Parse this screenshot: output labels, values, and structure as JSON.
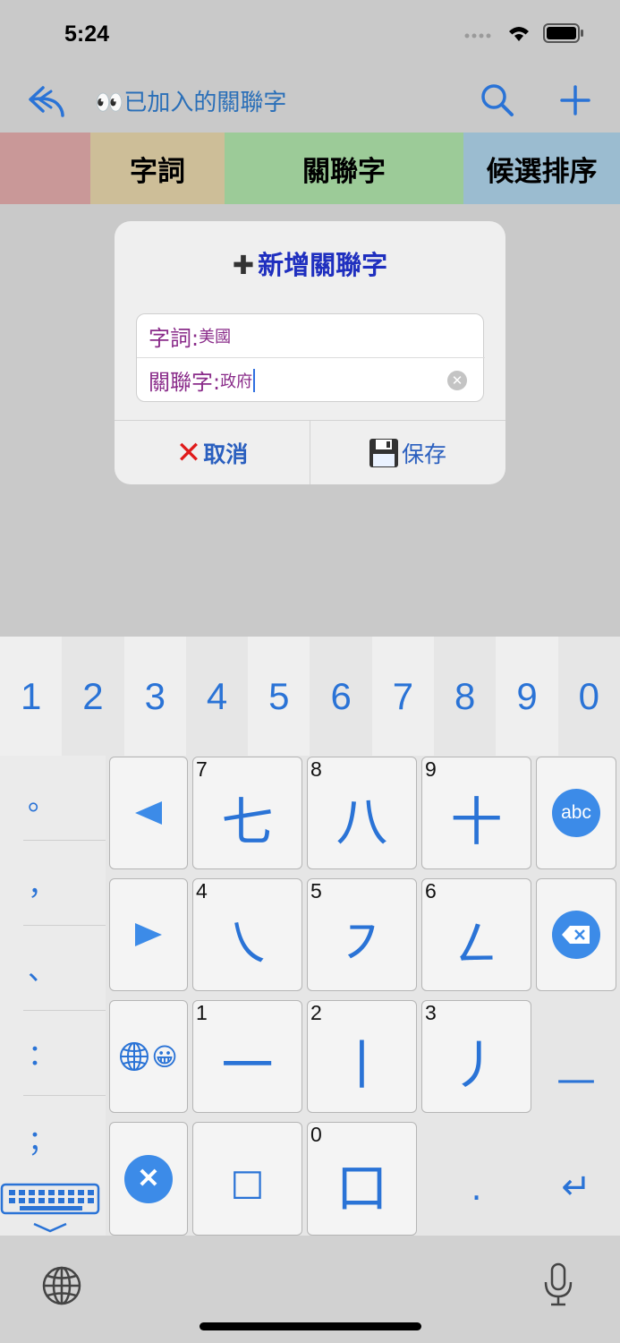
{
  "status": {
    "time": "5:24"
  },
  "nav": {
    "title": "👀已加入的關聯字"
  },
  "tabs": [
    "",
    "字詞",
    "關聯字",
    "候選排序"
  ],
  "dialog": {
    "title_icon": "✚",
    "title": "新增關聯字",
    "fields": [
      {
        "label": "字詞:",
        "value": "美國"
      },
      {
        "label": "關聯字:",
        "value": "政府"
      }
    ],
    "cancel_label": "取消",
    "cancel_icon": "✕",
    "save_label": "保存",
    "save_icon": "floppy-disk-icon"
  },
  "keyboard": {
    "numbers": [
      "1",
      "2",
      "3",
      "4",
      "5",
      "6",
      "7",
      "8",
      "9",
      "0"
    ],
    "punctuation": [
      "。",
      "，",
      "、",
      "：",
      "；"
    ],
    "stroke_keys": [
      {
        "digit": "7",
        "stroke": "七"
      },
      {
        "digit": "8",
        "stroke": "八"
      },
      {
        "digit": "9",
        "stroke": "十"
      },
      {
        "digit": "4",
        "stroke": "㇏"
      },
      {
        "digit": "5",
        "stroke": "㇇"
      },
      {
        "digit": "6",
        "stroke": "㇜"
      },
      {
        "digit": "1",
        "stroke": "一"
      },
      {
        "digit": "2",
        "stroke": "丨"
      },
      {
        "digit": "3",
        "stroke": "丿"
      },
      {
        "digit": "0",
        "stroke": "口"
      }
    ],
    "abc_label": "abc",
    "emoji": "😀",
    "square": "□",
    "dot": ".",
    "underscore": "—",
    "enter": "↵"
  },
  "colors": {
    "accent": "#2a73d6",
    "tab_0": "#c99898",
    "tab_1": "#cdbe98",
    "tab_2": "#9ccb98",
    "tab_3": "#9bbcd0",
    "field_text": "#8a2c8a",
    "dialog_title": "#1f2fbf"
  }
}
